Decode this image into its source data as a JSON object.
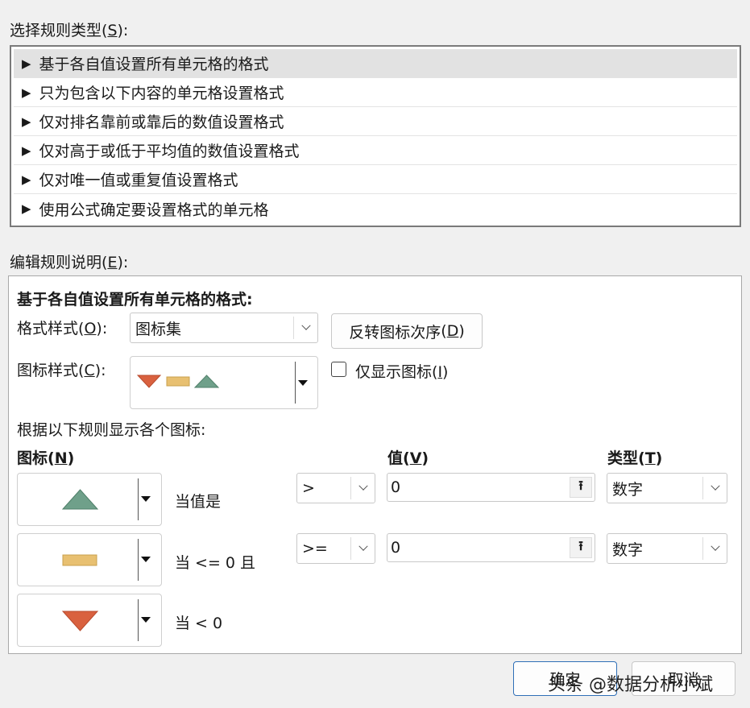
{
  "rule_type": {
    "label": "选择规则类型",
    "accel": "S",
    "items": [
      {
        "label": "基于各自值设置所有单元格的格式",
        "selected": true
      },
      {
        "label": "只为包含以下内容的单元格设置格式"
      },
      {
        "label": "仅对排名靠前或靠后的数值设置格式"
      },
      {
        "label": "仅对高于或低于平均值的数值设置格式"
      },
      {
        "label": "仅对唯一值或重复值设置格式"
      },
      {
        "label": "使用公式确定要设置格式的单元格"
      }
    ]
  },
  "edit": {
    "label": "编辑规则说明",
    "accel": "E",
    "header": "基于各自值设置所有单元格的格式:",
    "format_style": {
      "label": "格式样式",
      "accel": "O",
      "value": "图标集"
    },
    "reverse_button": {
      "label": "反转图标次序",
      "accel": "D"
    },
    "icon_style": {
      "label": "图标样式",
      "accel": "C"
    },
    "show_icon_only": {
      "label": "仅显示图标",
      "accel": "I",
      "checked": false
    },
    "rules_caption": "根据以下规则显示各个图标:",
    "col_icon": {
      "label": "图标",
      "accel": "N"
    },
    "col_value": {
      "label": "值",
      "accel": "V"
    },
    "col_type": {
      "label": "类型",
      "accel": "T"
    },
    "rows": [
      {
        "icon": "green-triangle-up",
        "condition": "当值是",
        "operator": ">",
        "value": "0",
        "type": "数字"
      },
      {
        "icon": "yellow-bar",
        "condition": "当 <= 0 且",
        "operator": ">=",
        "value": "0",
        "type": "数字"
      },
      {
        "icon": "red-triangle-down",
        "condition": "当 < 0"
      }
    ]
  },
  "footer": {
    "ok_label": "确定",
    "cancel_label": "取消"
  },
  "watermark": "头条 @数据分析小斌",
  "colors": {
    "icon_green": "#6fa08a",
    "icon_yellow": "#e8c071",
    "icon_red": "#d9613f"
  }
}
